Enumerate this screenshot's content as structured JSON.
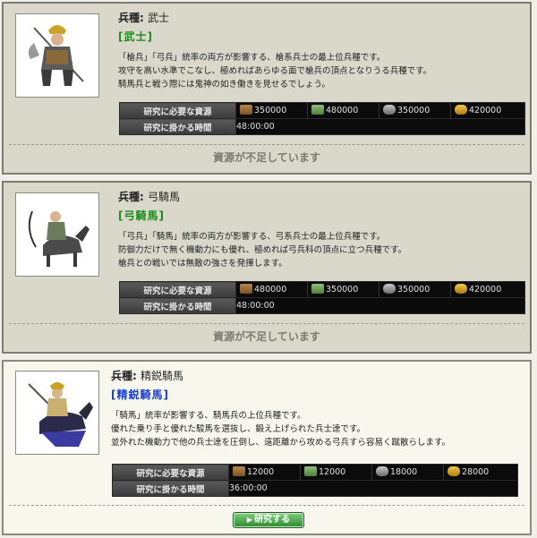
{
  "units": [
    {
      "type_label": "兵種",
      "type_name": "武士",
      "tag": "[武士]",
      "description": "「槍兵」「弓兵」統率の両方が影響する、槍系兵士の最上位兵種です。\n攻守を高い水準でこなし、極めればあらゆる面で槍兵の頂点となりうる兵種です。\n騎馬兵と戦う際には鬼神の如き働きを見せるでしょう。",
      "research_resources_label": "研究に必要な資源",
      "research_time_label": "研究に掛かる時間",
      "resources": {
        "wood": "350000",
        "cloth": "480000",
        "stone": "350000",
        "grain": "420000"
      },
      "time": "48:00:00",
      "status": "資源が不足しています"
    },
    {
      "type_label": "兵種",
      "type_name": "弓騎馬",
      "tag": "[弓騎馬]",
      "description": "「弓兵」「騎馬」統率の両方が影響する、弓系兵士の最上位兵種です。\n防御力だけで無く機動力にも優れ、極めれば弓兵科の頂点に立つ兵種です。\n槍兵との戦いでは無敵の強さを発揮します。",
      "research_resources_label": "研究に必要な資源",
      "research_time_label": "研究に掛かる時間",
      "resources": {
        "wood": "480000",
        "cloth": "350000",
        "stone": "350000",
        "grain": "420000"
      },
      "time": "48:00:00",
      "status": "資源が不足しています"
    },
    {
      "type_label": "兵種",
      "type_name": "精鋭騎馬",
      "tag": "[精鋭騎馬]",
      "description": "「騎馬」統率が影響する、騎馬兵の上位兵種です。\n優れた乗り手と優れた駿馬を選抜し、鍛え上げられた兵士達です。\n並外れた機動力で他の兵士達を圧倒し、遠距離から攻める弓兵すら容易く蹴散らします。",
      "research_resources_label": "研究に必要な資源",
      "research_time_label": "研究に掛かる時間",
      "resources": {
        "wood": "12000",
        "cloth": "12000",
        "stone": "18000",
        "grain": "28000"
      },
      "time": "36:00:00",
      "button_label": "研究する"
    }
  ],
  "icons": {
    "wood": "lumber-icon",
    "cloth": "cloth-icon",
    "stone": "stone-icon",
    "grain": "grain-icon"
  },
  "colors": {
    "tag_green": "#1e8a1e",
    "tag_blue": "#1a3fd0",
    "button": "#2f8a2f"
  }
}
